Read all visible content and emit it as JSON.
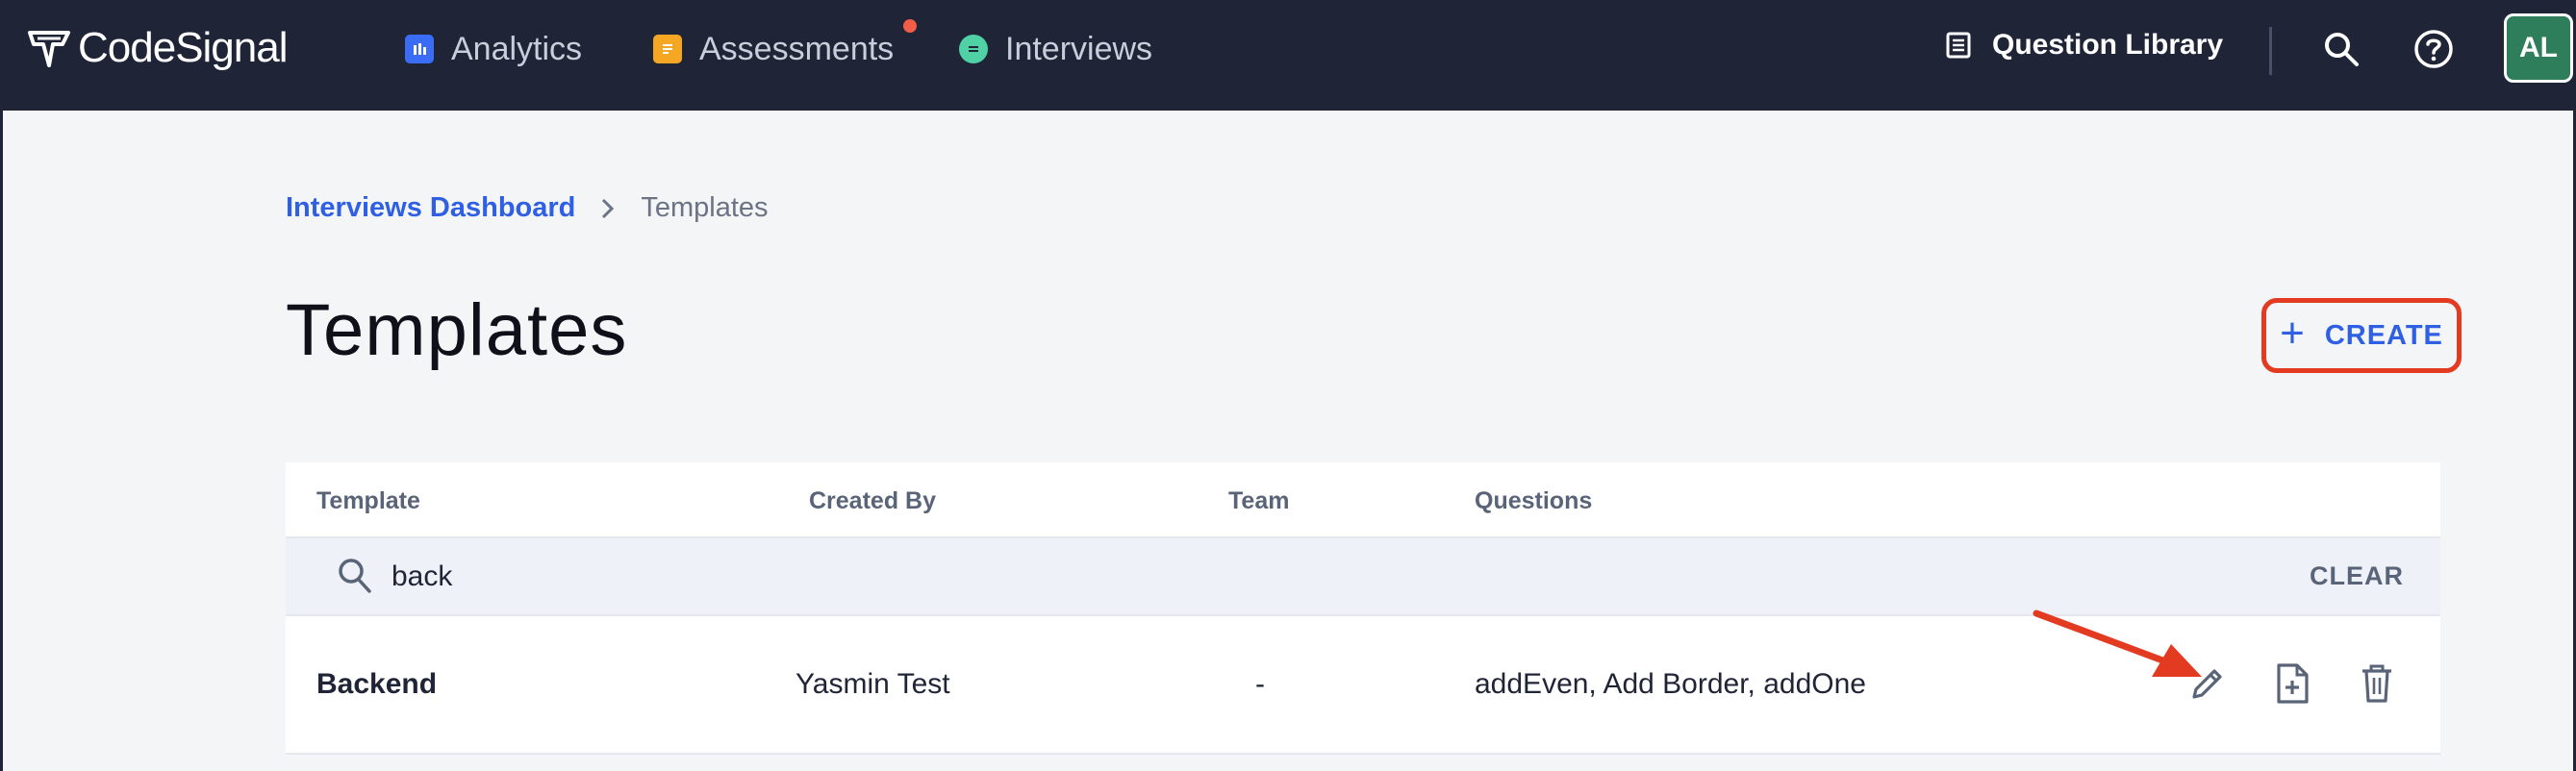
{
  "brand": {
    "name": "CodeSignal"
  },
  "nav": {
    "items": [
      {
        "label": "Analytics",
        "icon": "analytics-icon",
        "color": "#3b6cf5"
      },
      {
        "label": "Assessments",
        "icon": "assessments-icon",
        "color": "#f5a623"
      },
      {
        "label": "Interviews",
        "icon": "interviews-icon",
        "color": "#4fd1a5"
      }
    ],
    "question_library": "Question Library",
    "avatar_initials": "AL"
  },
  "breadcrumb": {
    "parent": "Interviews Dashboard",
    "current": "Templates"
  },
  "page": {
    "title": "Templates",
    "create_label": "CREATE"
  },
  "table": {
    "headers": [
      "Template",
      "Created By",
      "Team",
      "Questions"
    ],
    "search": {
      "value": "back"
    },
    "clear_label": "CLEAR",
    "rows": [
      {
        "template": "Backend",
        "created_by": "Yasmin Test",
        "team": "-",
        "questions": "addEven, Add Border, addOne"
      }
    ]
  },
  "colors": {
    "accent": "#2f5fe3",
    "nav_bg": "#1f2437",
    "highlight": "#e23b22"
  }
}
